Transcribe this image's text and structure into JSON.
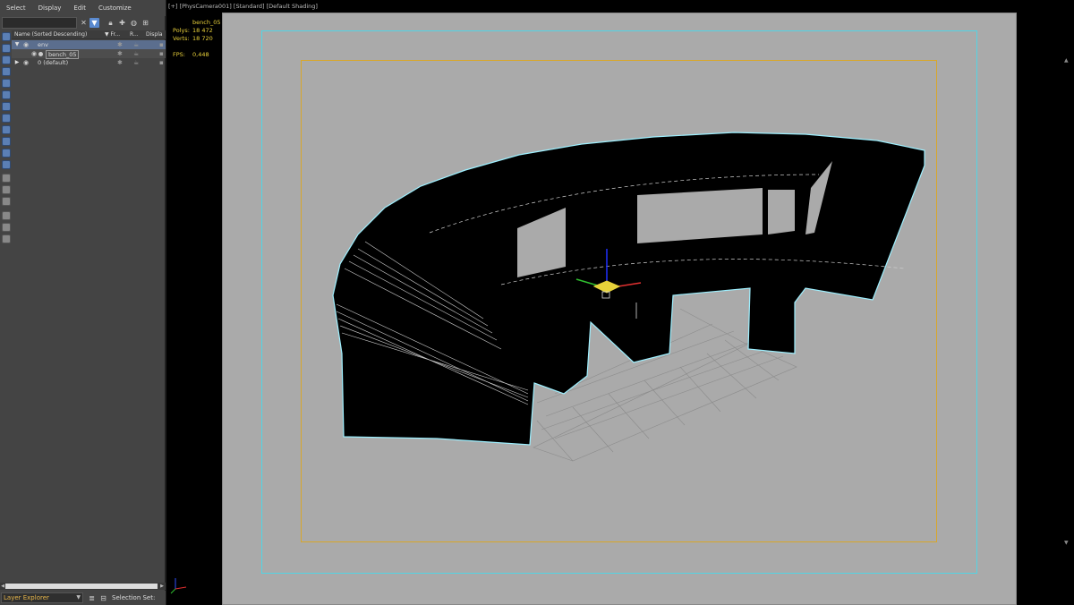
{
  "menu": {
    "items": [
      "Select",
      "Display",
      "Edit",
      "Customize"
    ]
  },
  "search": {
    "value": "",
    "placeholder": ""
  },
  "columns": {
    "name": "Name (Sorted Descending)",
    "frozen": "▼ Fr...",
    "render": "R...",
    "display": "Displa"
  },
  "tree": {
    "rows": [
      {
        "label": "env",
        "icon": "layer-icon"
      },
      {
        "label": "bench_05",
        "icon": "object-icon"
      },
      {
        "label": "0 (default)",
        "icon": "layer-icon"
      }
    ]
  },
  "bottom": {
    "explorer": "Layer Explorer",
    "selection_set": "Selection Set:"
  },
  "viewport": {
    "label": "[+] [PhysCamera001] [Standard] [Default Shading]",
    "object": "bench_05",
    "polys_label": "Polys:",
    "polys": "18 472",
    "verts_label": "Verts:",
    "verts": "18 720",
    "fps_label": "FPS:",
    "fps": "0,448"
  },
  "colors": {
    "safe_frame_outer": "#52d4e4",
    "safe_frame_inner": "#d8a72a",
    "viewport_bg": "#aaaaaa",
    "stats_text": "#e8d03a",
    "selection_outline": "#9ef0ff"
  }
}
